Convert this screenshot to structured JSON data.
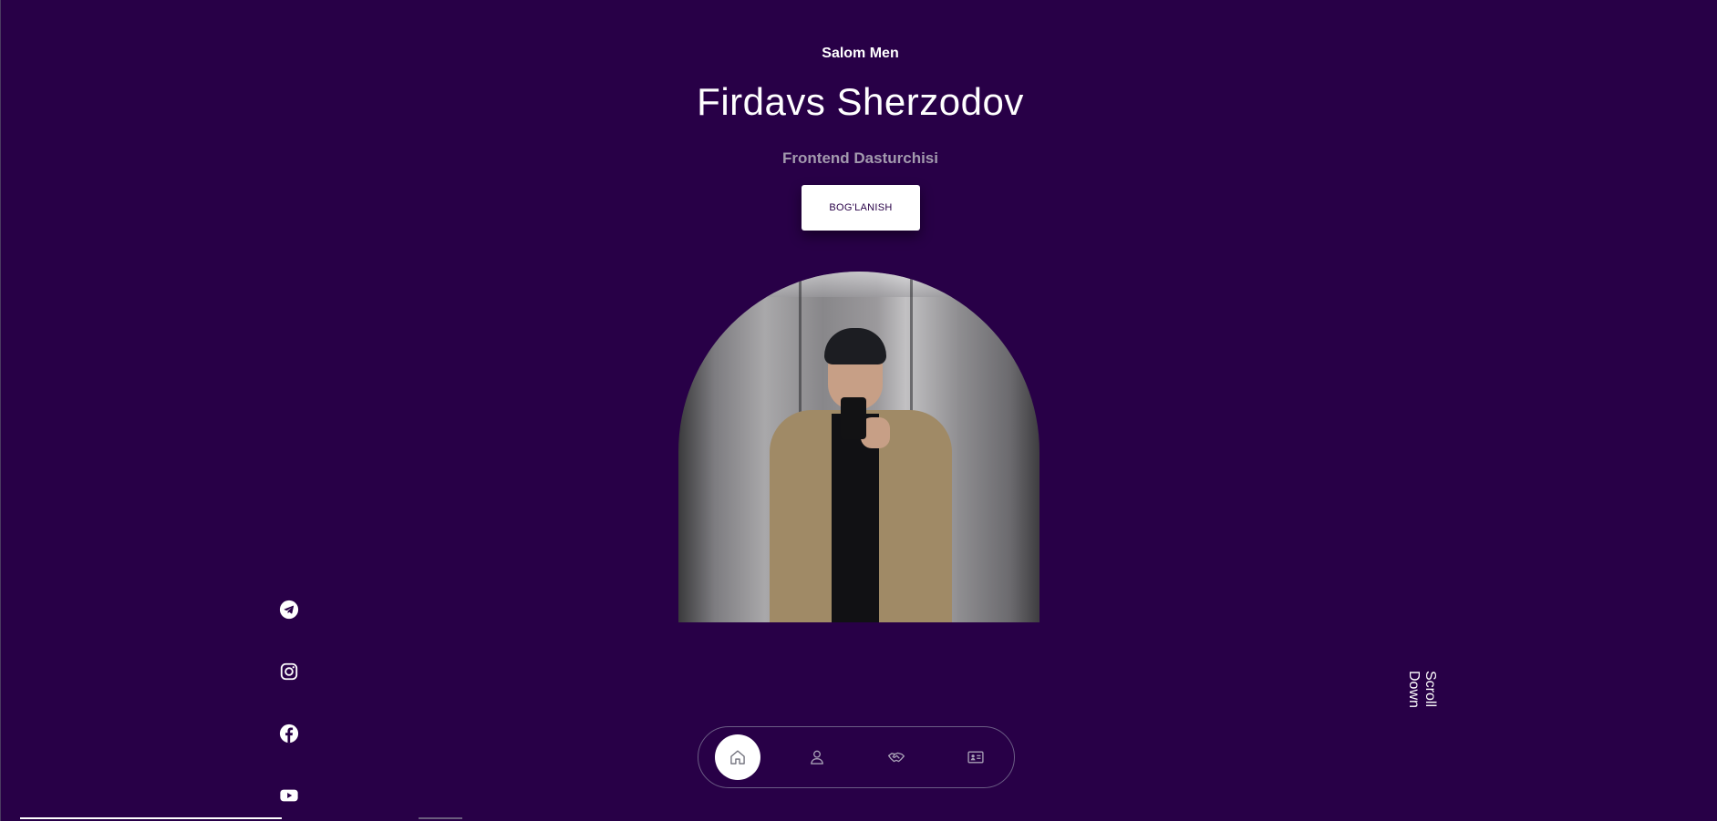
{
  "hero": {
    "greeting": "Salom Men",
    "name": "Firdavs Sherzodov",
    "role": "Frontend Dasturchisi",
    "contact_button": "BOG'LANISH"
  },
  "social": [
    {
      "icon": "telegram-icon"
    },
    {
      "icon": "instagram-icon"
    },
    {
      "icon": "facebook-icon"
    },
    {
      "icon": "youtube-icon"
    }
  ],
  "scroll_down": "Scroll Down",
  "nav": [
    {
      "icon": "home-icon",
      "active": true
    },
    {
      "icon": "user-icon",
      "active": false
    },
    {
      "icon": "handshake-icon",
      "active": false
    },
    {
      "icon": "contact-card-icon",
      "active": false
    }
  ],
  "colors": {
    "background": "#280047",
    "accent": "#ffffff",
    "muted_text": "#a39aae"
  }
}
